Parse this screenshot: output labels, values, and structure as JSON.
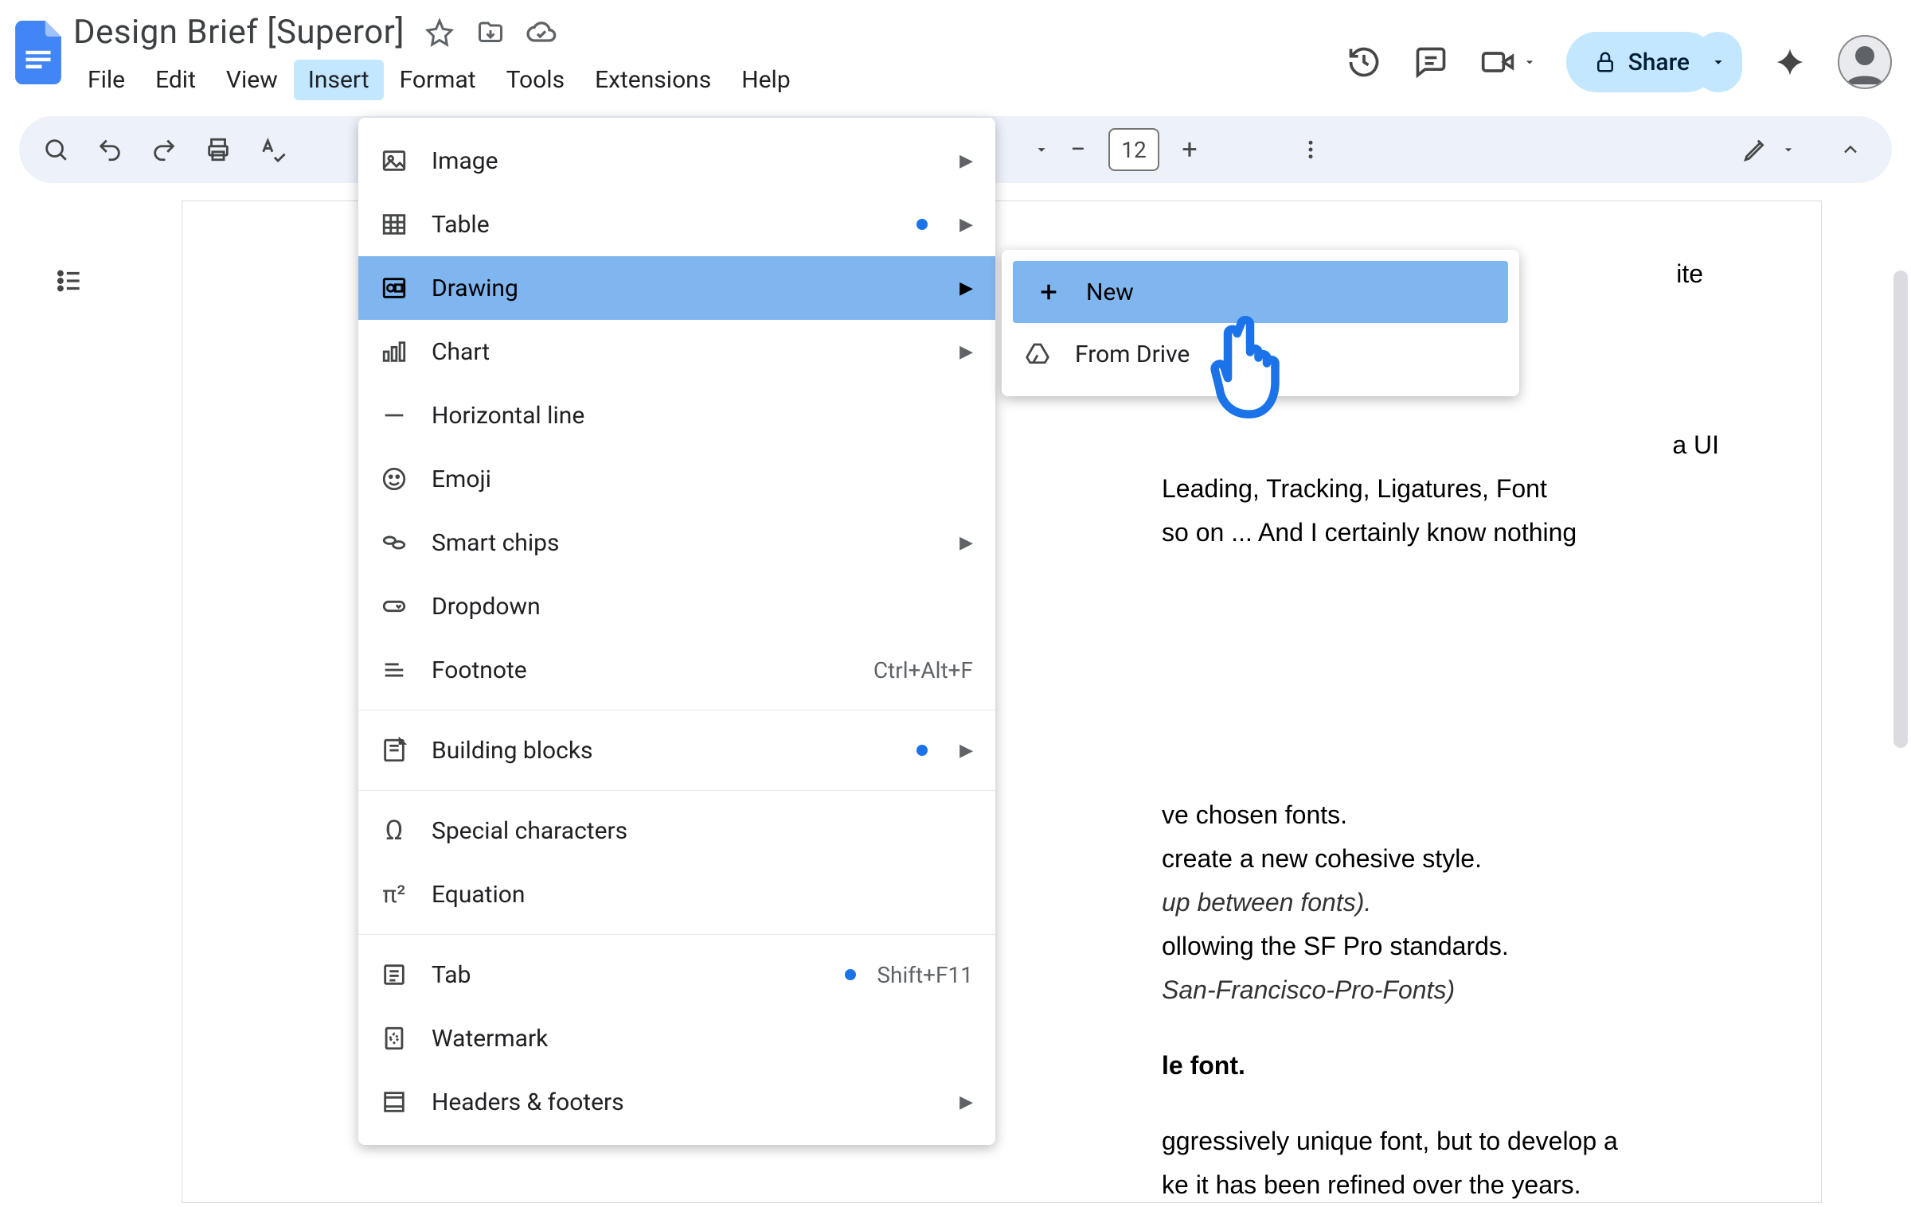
{
  "doc_title": "Design Brief [Superor]",
  "menu": {
    "file": "File",
    "edit": "Edit",
    "view": "View",
    "insert": "Insert",
    "format": "Format",
    "tools": "Tools",
    "extensions": "Extensions",
    "help": "Help"
  },
  "share_label": "Share",
  "font_size": "12",
  "insert_menu": {
    "image": "Image",
    "table": "Table",
    "drawing": "Drawing",
    "chart": "Chart",
    "horizontal_line": "Horizontal line",
    "emoji": "Emoji",
    "smart_chips": "Smart chips",
    "dropdown": "Dropdown",
    "footnote": "Footnote",
    "footnote_shortcut": "Ctrl+Alt+F",
    "building_blocks": "Building blocks",
    "special_characters": "Special characters",
    "equation": "Equation",
    "tab": "Tab",
    "tab_shortcut": "Shift+F11",
    "watermark": "Watermark",
    "headers_footers": "Headers & footers"
  },
  "drawing_submenu": {
    "new": "New",
    "from_drive": "From Drive"
  },
  "body": {
    "l1": "ite",
    "l2": "a UI",
    "l3": "Leading, Tracking, Ligatures, Font",
    "l4": "so on ... And I certainly know nothing",
    "l5": "ve chosen fonts.",
    "l6": "create a new cohesive style.",
    "l7": "up between fonts).",
    "l8": "ollowing the SF Pro standards.",
    "l9": "San-Francisco-Pro-Fonts)",
    "l10": "le font.",
    "l11": "ggressively unique font, but to develop a",
    "l12": "ke it has been refined over the years."
  }
}
